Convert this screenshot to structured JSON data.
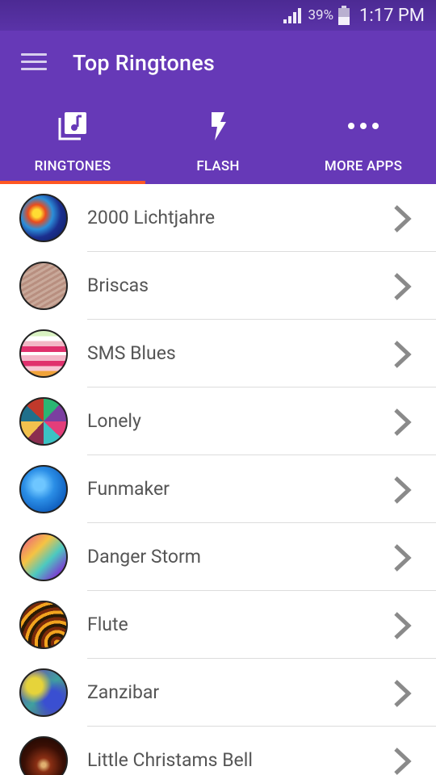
{
  "status_bar": {
    "battery_percent": "39%",
    "time": "1:17 PM"
  },
  "app_bar": {
    "title": "Top Ringtones",
    "menu_icon": "hamburger-menu-icon"
  },
  "tabs": [
    {
      "label": "RINGTONES",
      "icon": "music-library-icon",
      "selected": true
    },
    {
      "label": "FLASH",
      "icon": "flash-icon",
      "selected": false
    },
    {
      "label": "MORE APPS",
      "icon": "more-dots-icon",
      "selected": false
    }
  ],
  "colors": {
    "primary": "#6639b7",
    "status_bar": "#4c2a93",
    "tab_indicator": "#ff5722",
    "item_text": "#555555",
    "chevron": "#8a8a8a"
  },
  "ringtones": [
    {
      "title": "2000 Lichtjahre",
      "thumb": "colorful-swirl"
    },
    {
      "title": "Briscas",
      "thumb": "wood-diagonal"
    },
    {
      "title": "SMS Blues",
      "thumb": "pink-stripes"
    },
    {
      "title": "Lonely",
      "thumb": "triangle-mosaic"
    },
    {
      "title": "Funmaker",
      "thumb": "blue-texture"
    },
    {
      "title": "Danger Storm",
      "thumb": "rainbow-dots"
    },
    {
      "title": "Flute",
      "thumb": "fire-swirl"
    },
    {
      "title": "Zanzibar",
      "thumb": "blurry-colors"
    },
    {
      "title": "Little Christams Bell",
      "thumb": "dark-swirl"
    }
  ]
}
